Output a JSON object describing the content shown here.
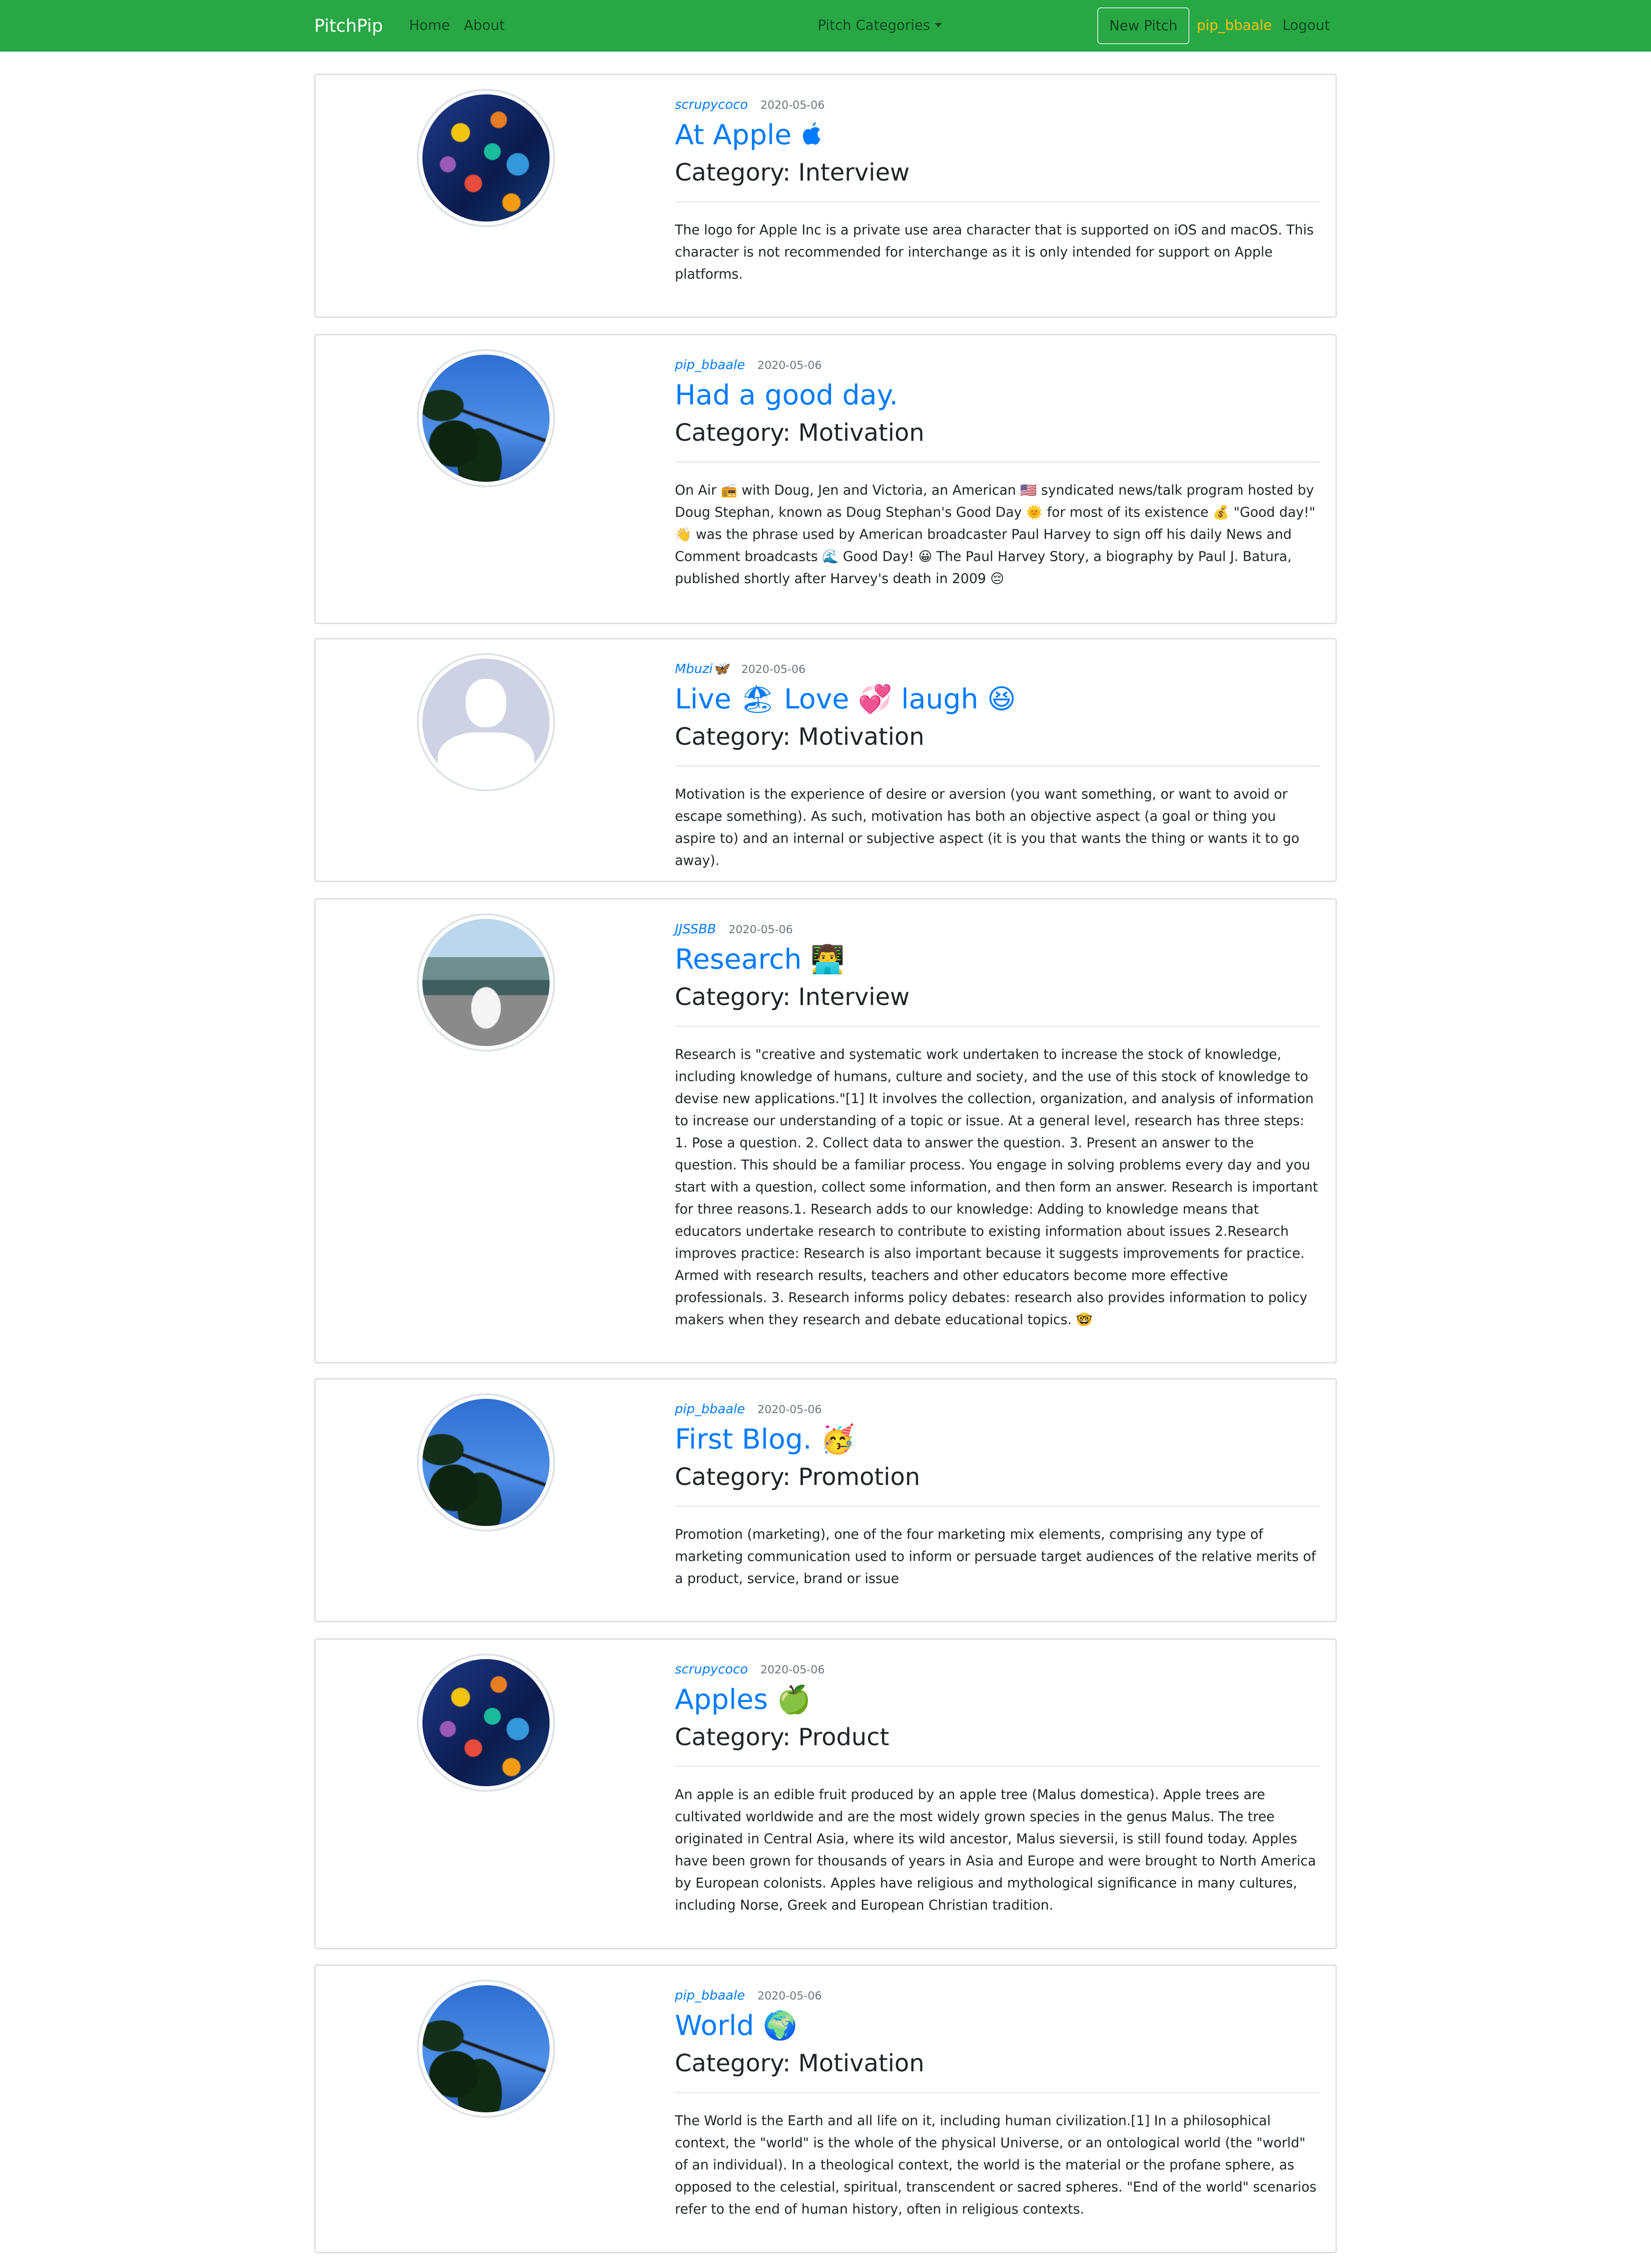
{
  "navbar": {
    "brand": "PitchPip",
    "home": "Home",
    "about": "About",
    "categories": "Pitch Categories",
    "new_pitch": "New Pitch",
    "user": "pip_bbaale",
    "logout": "Logout"
  },
  "colors": {
    "navbar": "#28a745",
    "link": "#007bff",
    "user": "#ffc107"
  },
  "pitches": [
    {
      "author": "scrupycoco",
      "date": "2020-05-06",
      "title": "At Apple",
      "title_icon": "apple-logo-icon",
      "category": "Category: Interview",
      "text": "The logo for Apple Inc is a private use area character that is supported on iOS and macOS. This character is not recommended for interchange as it is only intended for support on Apple platforms."
    },
    {
      "author": "pip_bbaale",
      "date": "2020-05-06",
      "title": "Had a good day.",
      "category": "Category: Motivation",
      "text": "On Air 📻  with Doug, Jen and Victoria, an American 🇺🇸  syndicated news/talk program hosted by Doug Stephan, known as Doug Stephan's Good Day 🌞  for most of its existence 💰  \"Good day!\" 👋  was the phrase used by American broadcaster Paul Harvey to sign off his daily News and Comment broadcasts 🌊  Good Day! 😀  The Paul Harvey Story, a biography by Paul J. Batura, published shortly after Harvey's death in 2009 😔"
    },
    {
      "author": "Mbuzi🦋",
      "date": "2020-05-06",
      "title": "Live 🏖 Love 💞 laugh 😆",
      "category": "Category: Motivation",
      "text": "Motivation is the experience of desire or aversion (you want something, or want to avoid or escape something). As such, motivation has both an objective aspect (a goal or thing you aspire to) and an internal or subjective aspect (it is you that wants the thing or wants it to go away)."
    },
    {
      "author": "JJSSBB",
      "date": "2020-05-06",
      "title": "Research 👨‍💻",
      "category": "Category: Interview",
      "text": "Research is \"creative and systematic work undertaken to increase the stock of knowledge, including knowledge of humans, culture and society, and the use of this stock of knowledge to devise new applications.\"[1] It involves the collection, organization, and analysis of information to increase our understanding of a topic or issue. At a general level, research has three steps: 1. Pose a question. 2. Collect data to answer the question. 3. Present an answer to the question. This should be a familiar process. You engage in solving problems every day and you start with a question, collect some information, and then form an answer. Research is important for three reasons.1. Research adds to our knowledge: Adding to knowledge means that educators undertake research to contribute to existing information about issues 2.Research improves practice: Research is also important because it suggests improvements for practice. Armed with research results, teachers and other educators become more effective professionals. 3. Research informs policy debates: research also provides information to policy makers when they research and debate educational topics. 🤓"
    },
    {
      "author": "pip_bbaale",
      "date": "2020-05-06",
      "title": "First Blog. 🥳",
      "category": "Category: Promotion",
      "text": "Promotion (marketing), one of the four marketing mix elements, comprising any type of marketing communication used to inform or persuade target audiences of the relative merits of a product, service, brand or issue"
    },
    {
      "author": "scrupycoco",
      "date": "2020-05-06",
      "title": "Apples 🍏",
      "category": "Category: Product",
      "text": "An apple is an edible fruit produced by an apple tree (Malus domestica). Apple trees are cultivated worldwide and are the most widely grown species in the genus Malus. The tree originated in Central Asia, where its wild ancestor, Malus sieversii, is still found today. Apples have been grown for thousands of years in Asia and Europe and were brought to North America by European colonists. Apples have religious and mythological significance in many cultures, including Norse, Greek and European Christian tradition."
    },
    {
      "author": "pip_bbaale",
      "date": "2020-05-06",
      "title": "World 🌍",
      "category": "Category: Motivation",
      "text": "The World is the Earth and all life on it, including human civilization.[1] In a philosophical context, the \"world\" is the whole of the physical Universe, or an ontological world (the \"world\" of an individual). In a theological context, the world is the material or the profane sphere, as opposed to the celestial, spiritual, transcendent or sacred spheres. \"End of the world\" scenarios refer to the end of human history, often in religious contexts."
    }
  ]
}
